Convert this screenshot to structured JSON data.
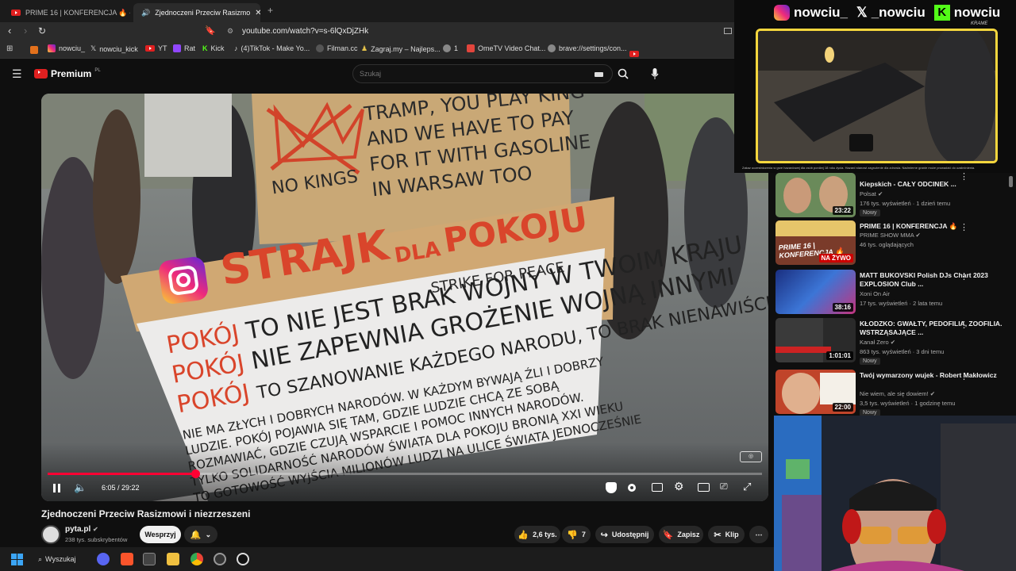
{
  "tabs": [
    {
      "label": "PRIME 16 | KONFERENCJA 🔥 - Y"
    },
    {
      "label": "Zjednoczeni Przeciw Rasizmo"
    }
  ],
  "address": "youtube.com/watch?v=s-6lQxDjZHk",
  "bookmarks": [
    "nowciu_",
    "nowciu_kick",
    "YT",
    "Rat",
    "Kick",
    "(4)TikTok - Make Yo...",
    "Filman.cc",
    "Zagraj.my – Najleps...",
    "1",
    "OmeTV Video Chat...",
    "brave://settings/con..."
  ],
  "youtube": {
    "logo": "Premium",
    "logo_region": "PL",
    "search_placeholder": "Szukaj"
  },
  "player": {
    "time": "6:05 / 29:22",
    "progress": 0.207
  },
  "video": {
    "title": "Zjednoczeni Przeciw Rasizmowi i niezrzeszeni",
    "channel": "pyta.pl",
    "subscribers": "238 tys. subskrybentów",
    "support_label": "Wesprzyj",
    "likes": "2,6 tys.",
    "dislikes": "7",
    "share_label": "Udostępnij",
    "save_label": "Zapisz",
    "clip_label": "Klip"
  },
  "sign": {
    "top_left": "NO KINGS",
    "top_right": [
      "TRAMP, YOU PLAY KING",
      "AND WE HAVE TO PAY",
      "FOR IT WITH GASOLINE",
      "IN WARSAW TOO"
    ],
    "mid_main": "STRAJK",
    "mid_dla": "DLA",
    "mid_pokoju": "POKOJU",
    "mid_en": "STRIKE FOR PEACE",
    "lines": [
      {
        "red": "POKÓJ",
        "black": "TO NIE JEST  BRAK WOJNY W TWOIM KRAJU"
      },
      {
        "red": "POKÓJ",
        "black": "NIE ZAPEWNIA  GROŻENIE WOJNĄ INNYMI"
      },
      {
        "red": "POKÓJ",
        "black": "TO SZANOWANIE KAŻDEGO NARODU, TO BRAK NIENAWIŚCI"
      }
    ],
    "small": [
      "NIE MA ZŁYCH I DOBRYCH NARODÓW. W KAŻDYM BYWAJĄ ŹLI I DOBRZY",
      "LUDZIE. POKÓJ POJAWIA SIĘ TAM, GDZIE LUDZIE CHCĄ ZE SOBĄ",
      "ROZMAWIAĆ, GDZIE CZUJĄ WSPARCIE I POMOC INNYCH NARODÓW.",
      "TYLKO SOLIDARNOŚĆ NARODÓW ŚWIATA DLA POKOJU BRONIĄ XXI WIEKU",
      "TO GOTOWOŚĆ WYJŚCIA MILIONÓW LUDZI NA ULICE ŚWIATA JEDNOCZEŚNIE"
    ]
  },
  "overlay": {
    "instagram": "nowciu_",
    "x": "_nowciu",
    "kick": "nowciu",
    "kick_brand": "KRAME",
    "caption": "Zakaz uczestniczenia w grze hazardowej dla osób poniżej 18 roku życia. Hazard stanowi zagrożenie dla zdrowia. Nadmierne granie może prowadzić do uzależnienia."
  },
  "recommendations": [
    {
      "title": "Kiepskich - CAŁY ODCINEK ...",
      "channel": "Polsat",
      "meta": "176 tys. wyświetleń · 1 dzień temu",
      "duration": "23:22",
      "new": "Nowy",
      "color": "#6a8a5a"
    },
    {
      "title": "PRIME 16 | KONFERENCJA 🔥",
      "channel": "PRIME SHOW MMA",
      "meta": "46 tys. oglądających",
      "duration": "NA ŻYWO",
      "new": "",
      "color": "#7a3b2a"
    },
    {
      "title": "MATT BUKOVSKI Polish DJs Chart 2023 EXPLOSION Club ...",
      "channel": "Xoni On Air",
      "meta": "17 tys. wyświetleń · 2 lata temu",
      "duration": "38:16",
      "new": "",
      "color": "#1d3d8a"
    },
    {
      "title": "KŁODZKO: GWAŁTY, PEDOFILIA, ZOOFILIA. WSTRZĄSAJĄCE ...",
      "channel": "Kanał Zero",
      "meta": "863 tys. wyświetleń · 3 dni temu",
      "duration": "1:01:01",
      "new": "Nowy",
      "color": "#2a2a2a"
    },
    {
      "title": "Twój wymarzony wujek - Robert Makłowicz",
      "channel": "Nie wiem, ale się dowiem!",
      "meta": "3,5 tys. wyświetleń · 1 godzinę temu",
      "duration": "22:00",
      "new": "Nowy",
      "color": "#c0442a"
    }
  ],
  "taskbar": {
    "search_label": "Wyszukaj"
  }
}
